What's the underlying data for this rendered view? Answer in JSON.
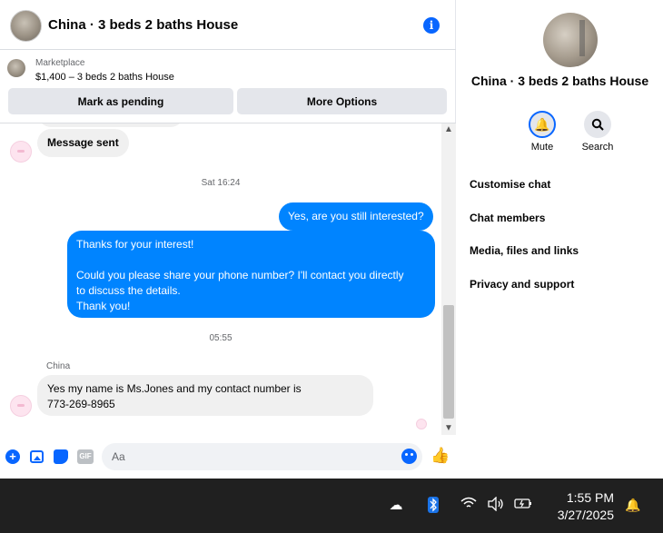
{
  "chat": {
    "title": "China · 3 beds 2 baths House",
    "listing": {
      "label": "Marketplace",
      "price_title": "$1,400 – 3 beds 2 baths House",
      "mark_pending": "Mark as pending",
      "more_options": "More Options"
    },
    "messages": {
      "sent_notice": "Message sent",
      "timestamp_1": "Sat 16:24",
      "out_1": "Yes, are you still interested?",
      "out_2": "Thanks for your interest!\n\nCould you please share your phone number? I'll contact you directly\nto discuss the details.\nThank you!",
      "timestamp_2": "05:55",
      "sender_name": "China",
      "in_1_line1": "Yes my name is Ms.Jones and my contact number is",
      "in_1_line2": "773-269-8965"
    },
    "composer": {
      "placeholder": "Aa",
      "gif_label": "GIF"
    },
    "icons": {
      "info": "info-icon",
      "plus": "plus-icon",
      "photo": "photo-icon",
      "sticker": "sticker-icon",
      "emoji": "emoji-icon",
      "like": "thumbs-up-icon"
    }
  },
  "details": {
    "title": "China · 3 beds 2 baths House",
    "mute_label": "Mute",
    "search_label": "Search",
    "menu": [
      "Customise chat",
      "Chat members",
      "Media, files and links",
      "Privacy and support"
    ]
  },
  "taskbar": {
    "time": "1:55 PM",
    "date": "3/27/2025"
  },
  "colors": {
    "accent": "#0866ff",
    "outgoing_bubble": "#0084ff",
    "incoming_bubble": "#f0f0f0",
    "taskbar": "#202020"
  }
}
